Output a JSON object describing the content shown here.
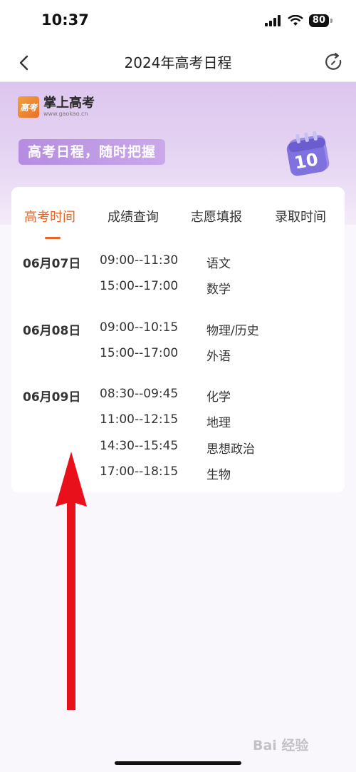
{
  "status_bar": {
    "time": "10:37",
    "battery": "80"
  },
  "nav": {
    "title": "2024年高考日程"
  },
  "hero": {
    "logo_badge": "高考",
    "logo_name": "掌上高考",
    "logo_url": "www.gaokao.cn",
    "slogan": "高考日程，随时把握",
    "calendar_number": "10"
  },
  "tabs": [
    {
      "label": "高考时间",
      "active": true
    },
    {
      "label": "成绩查询",
      "active": false
    },
    {
      "label": "志愿填报",
      "active": false
    },
    {
      "label": "录取时间",
      "active": false
    }
  ],
  "schedule": [
    {
      "date": "06月07日",
      "sessions": [
        {
          "time": "09:00--11:30",
          "subject": "语文"
        },
        {
          "time": "15:00--17:00",
          "subject": "数学"
        }
      ]
    },
    {
      "date": "06月08日",
      "sessions": [
        {
          "time": "09:00--10:15",
          "subject": "物理/历史"
        },
        {
          "time": "15:00--17:00",
          "subject": "外语"
        }
      ]
    },
    {
      "date": "06月09日",
      "sessions": [
        {
          "time": "08:30--09:45",
          "subject": "化学"
        },
        {
          "time": "11:00--12:15",
          "subject": "地理"
        },
        {
          "time": "14:30--15:45",
          "subject": "思想政治"
        },
        {
          "time": "17:00--18:15",
          "subject": "生物"
        }
      ]
    }
  ],
  "colors": {
    "accent": "#e8652a",
    "arrow": "#e8101a"
  },
  "watermark": "Bai 经验"
}
